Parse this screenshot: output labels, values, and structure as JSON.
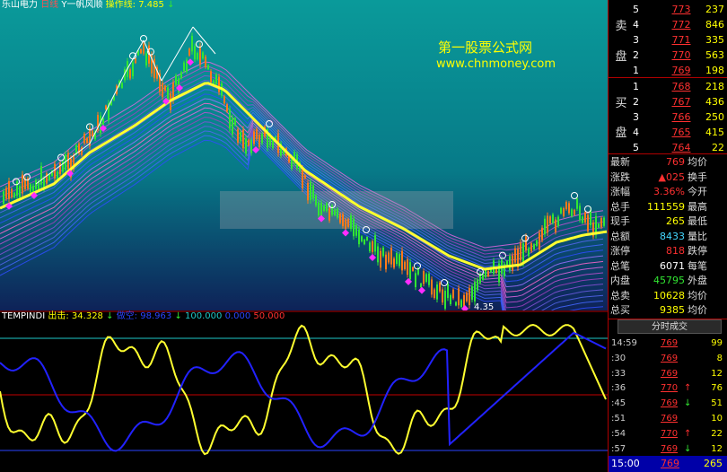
{
  "header": {
    "name": "乐山电力",
    "period": "日线",
    "indicator": "Y一帆风顺",
    "op_label": "操作线:",
    "op_value": "7.485",
    "arrow_down": "↓"
  },
  "watermark": {
    "line1": "第一股票公式网",
    "line2": "www.chnmoney.com"
  },
  "main_chart": {
    "low_price_label": "4.35",
    "colors": {
      "background_top": "#0a8a8a",
      "background_bottom": "#0e2a60",
      "ma_line": "#ffff30",
      "rising": "#ff7a1a",
      "falling": "#32e632",
      "signal": "#ff2cff"
    }
  },
  "indicator_panel": {
    "name": "TEMPINDI",
    "out_label": "出击:",
    "out_value": "34.328",
    "hold_label": "做空:",
    "hold_value": "98.963",
    "v1": "100.000",
    "v2": "0.000",
    "v3": "50.000",
    "arrow_down": "↓"
  },
  "quotes": {
    "sell_char_1": "卖",
    "sell_char_2": "盘",
    "buy_char_1": "买",
    "buy_char_2": "盘",
    "sell": [
      {
        "level": "5",
        "price": "773",
        "vol": "237"
      },
      {
        "level": "4",
        "price": "772",
        "vol": "846"
      },
      {
        "level": "3",
        "price": "771",
        "vol": "335"
      },
      {
        "level": "2",
        "price": "770",
        "vol": "563"
      },
      {
        "level": "1",
        "price": "769",
        "vol": "198"
      }
    ],
    "buy": [
      {
        "level": "1",
        "price": "768",
        "vol": "218"
      },
      {
        "level": "2",
        "price": "767",
        "vol": "436"
      },
      {
        "level": "3",
        "price": "766",
        "vol": "250"
      },
      {
        "level": "4",
        "price": "765",
        "vol": "415"
      },
      {
        "level": "5",
        "price": "764",
        "vol": "22"
      }
    ]
  },
  "stats": [
    {
      "label": "最新",
      "value": "769",
      "color": "#ff3030",
      "label2": "均价"
    },
    {
      "label": "涨跌",
      "value": "▲025",
      "color": "#ff3030",
      "label2": "换手"
    },
    {
      "label": "涨幅",
      "value": "3.36%",
      "color": "#ff3030",
      "label2": "今开"
    },
    {
      "label": "总手",
      "value": "111559",
      "color": "#ffff00",
      "label2": "最高"
    },
    {
      "label": "现手",
      "value": "265",
      "color": "#ffff00",
      "label2": "最低"
    },
    {
      "label": "总额",
      "value": "8433",
      "color": "#44d7ff",
      "label2": "量比"
    },
    {
      "label": "涨停",
      "value": "818",
      "color": "#ff3030",
      "label2": "跌停"
    },
    {
      "label": "总笔",
      "value": "6071",
      "color": "#ffffff",
      "label2": "每笔"
    },
    {
      "label": "内盘",
      "value": "45795",
      "color": "#32e632",
      "label2": "外盘"
    },
    {
      "label": "总卖",
      "value": "10628",
      "color": "#ffff00",
      "label2": "均价"
    },
    {
      "label": "总买",
      "value": "9385",
      "color": "#ffff00",
      "label2": "均价"
    }
  ],
  "ticks": {
    "title": "分时成交",
    "rows": [
      {
        "time": "14:59",
        "price": "769",
        "arrow": "",
        "vol": "99"
      },
      {
        "time": ":30",
        "price": "769",
        "arrow": "",
        "vol": "8"
      },
      {
        "time": ":33",
        "price": "769",
        "arrow": "",
        "vol": "12"
      },
      {
        "time": ":36",
        "price": "770",
        "arrow": "↑",
        "vol": "76"
      },
      {
        "time": ":45",
        "price": "769",
        "arrow": "↓",
        "vol": "51"
      },
      {
        "time": ":51",
        "price": "769",
        "arrow": "",
        "vol": "10"
      },
      {
        "time": ":54",
        "price": "770",
        "arrow": "↑",
        "vol": "22"
      },
      {
        "time": ":57",
        "price": "769",
        "arrow": "↓",
        "vol": "12"
      }
    ],
    "last": {
      "time": "15:00",
      "price": "769",
      "vol": "265"
    }
  }
}
